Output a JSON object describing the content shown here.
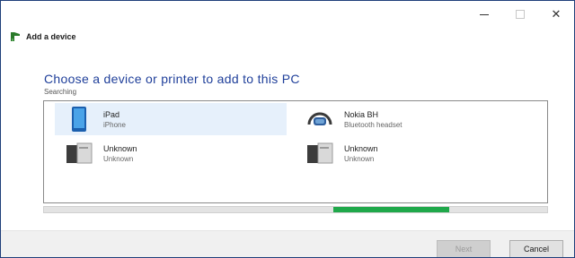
{
  "window": {
    "controls": {
      "close_glyph": "✕"
    }
  },
  "app": {
    "title": "Add a device",
    "icon": "add-device-icon"
  },
  "main": {
    "heading": "Choose a device or printer to add to this PC",
    "status": "Searching"
  },
  "devices": [
    {
      "name": "iPad",
      "type": "iPhone",
      "icon": "tablet-icon",
      "selected": true
    },
    {
      "name": "Nokia BH",
      "type": "Bluetooth headset",
      "icon": "headset-icon",
      "selected": false
    },
    {
      "name": "Unknown",
      "type": "Unknown",
      "icon": "generic-device-icon",
      "selected": false
    },
    {
      "name": "Unknown",
      "type": "Unknown",
      "icon": "generic-device-icon",
      "selected": false
    }
  ],
  "progress": {
    "fill_start": 0.575,
    "fill_end": 0.805,
    "color": "#1fa84a"
  },
  "footer": {
    "next_label": "Next",
    "cancel_label": "Cancel"
  },
  "colors": {
    "heading": "#1f3f9a",
    "border": "#1f3f7a",
    "selected_row": "#e6f0fb"
  }
}
